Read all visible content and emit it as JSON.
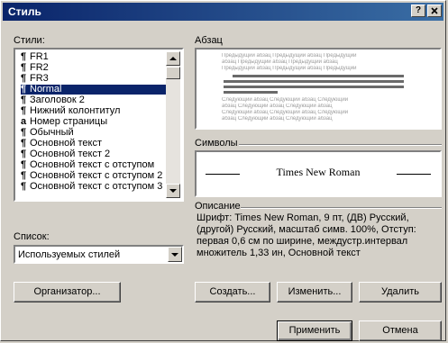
{
  "dialog": {
    "title": "Стиль",
    "help_button": "?",
    "close_button": "X"
  },
  "styles_label": "Стили:",
  "styles_list": [
    {
      "label": "FR1",
      "glyph": "¶"
    },
    {
      "label": "FR2",
      "glyph": "¶"
    },
    {
      "label": "FR3",
      "glyph": "¶"
    },
    {
      "label": "Normal",
      "glyph": "¶",
      "selected": true
    },
    {
      "label": "Заголовок 2",
      "glyph": "¶"
    },
    {
      "label": "Нижний колонтитул",
      "glyph": "¶"
    },
    {
      "label": "Номер страницы",
      "glyph": "a"
    },
    {
      "label": "Обычный",
      "glyph": "¶"
    },
    {
      "label": "Основной текст",
      "glyph": "¶"
    },
    {
      "label": "Основной текст 2",
      "glyph": "¶"
    },
    {
      "label": "Основной текст с отступом",
      "glyph": "¶"
    },
    {
      "label": "Основной текст с отступом 2",
      "glyph": "¶"
    },
    {
      "label": "Основной текст с отступом 3",
      "glyph": "¶"
    }
  ],
  "list_label": "Список:",
  "list_value": "Используемых стилей",
  "paragraph_label": "Абзац",
  "symbols_label": "Символы",
  "font_preview": "Times New Roman",
  "description_label": "Описание",
  "description_text": "Шрифт: Times New Roman, 9 пт, (ДВ) Русский, (другой) Русский, масштаб симв. 100%, Отступ: первая  0,6 см по ширине, междустр.интервал множитель 1,33 ин, Основной текст",
  "buttons": {
    "organizer": "Организатор...",
    "create": "Создать...",
    "modify": "Изменить...",
    "delete": "Удалить",
    "apply": "Применить",
    "cancel": "Отмена"
  }
}
